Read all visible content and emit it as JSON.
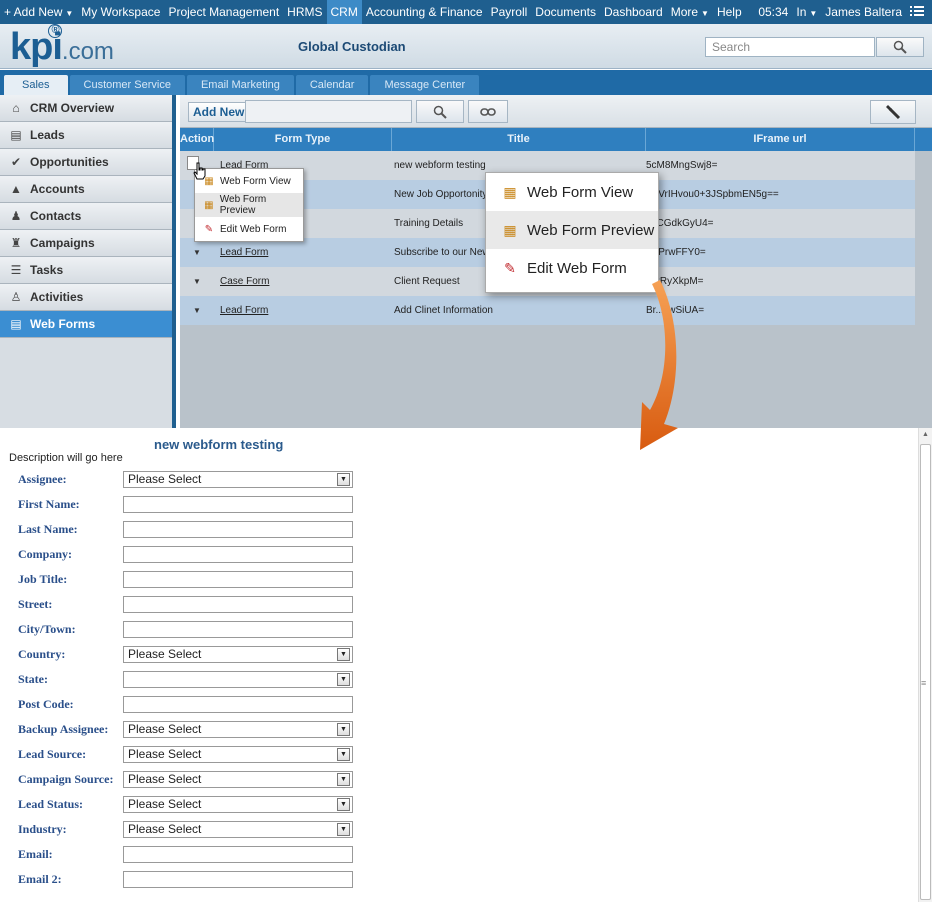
{
  "topnav": {
    "items": [
      "+ Add New",
      "My Workspace",
      "Project Management",
      "HRMS",
      "CRM",
      "Accounting & Finance",
      "Payroll",
      "Documents",
      "Dashboard",
      "More",
      "Help"
    ],
    "time": "05:34",
    "status": "In",
    "user": "James Baltera"
  },
  "header": {
    "logo_main": "kpi",
    "logo_suffix": ".com",
    "logo_mark": "®",
    "company": "Global Custodian",
    "search_placeholder": "Search"
  },
  "module_tabs": [
    "Sales",
    "Customer Service",
    "Email Marketing",
    "Calendar",
    "Message Center"
  ],
  "sidebar": {
    "items": [
      {
        "label": "CRM Overview",
        "icon": "home-icon"
      },
      {
        "label": "Leads",
        "icon": "document-icon"
      },
      {
        "label": "Opportunities",
        "icon": "check-icon"
      },
      {
        "label": "Accounts",
        "icon": "building-icon"
      },
      {
        "label": "Contacts",
        "icon": "contacts-icon"
      },
      {
        "label": "Campaigns",
        "icon": "campaign-icon"
      },
      {
        "label": "Tasks",
        "icon": "tasks-icon"
      },
      {
        "label": "Activities",
        "icon": "activities-icon"
      },
      {
        "label": "Web Forms",
        "icon": "webforms-icon"
      }
    ]
  },
  "toolbar": {
    "add_new": "Add New"
  },
  "grid": {
    "headers": [
      "Action",
      "Form Type",
      "Title",
      "IFrame url"
    ],
    "rows": [
      {
        "form_type": "Lead Form",
        "title": "new webform testing",
        "iframe": "5cM8MngSwj8="
      },
      {
        "form_type": "",
        "title": "New Job Opportonity",
        "iframe": "AuVrIHvou0+3JSpbmEN5g=="
      },
      {
        "form_type": "",
        "title": "Training Details",
        "iframe": "c6CGdkGyU4="
      },
      {
        "form_type": "Lead Form",
        "title": "Subscribe to our Newsletter",
        "iframe": "K0PrwFFY0="
      },
      {
        "form_type": "Case Form",
        "title": "Client Request",
        "iframe": "PjzRyXkpM="
      },
      {
        "form_type": "Lead Form",
        "title": "Add Clinet Information",
        "iframe": "Br..HwSiUA="
      }
    ]
  },
  "action_menu": {
    "items": [
      {
        "label": "Web Form View",
        "icon": "grid-icon"
      },
      {
        "label": "Web Form Preview",
        "icon": "grid-icon"
      },
      {
        "label": "Edit Web Form",
        "icon": "edit-icon"
      }
    ]
  },
  "form": {
    "title": "new webform testing",
    "description": "Description will go here",
    "fields": [
      {
        "label": "Assignee:",
        "value": "Please Select",
        "select": true
      },
      {
        "label": "First Name:",
        "value": "",
        "select": false
      },
      {
        "label": "Last Name:",
        "value": "",
        "select": false
      },
      {
        "label": "Company:",
        "value": "",
        "select": false
      },
      {
        "label": "Job Title:",
        "value": "",
        "select": false
      },
      {
        "label": "Street:",
        "value": "",
        "select": false
      },
      {
        "label": "City/Town:",
        "value": "",
        "select": false
      },
      {
        "label": "Country:",
        "value": "Please Select",
        "select": true
      },
      {
        "label": "State:",
        "value": "",
        "select": true
      },
      {
        "label": "Post Code:",
        "value": "",
        "select": false
      },
      {
        "label": "Backup Assignee:",
        "value": "Please Select",
        "select": true
      },
      {
        "label": "Lead Source:",
        "value": "Please Select",
        "select": true
      },
      {
        "label": "Campaign Source:",
        "value": "Please Select",
        "select": true
      },
      {
        "label": "Lead Status:",
        "value": "Please Select",
        "select": true
      },
      {
        "label": "Industry:",
        "value": "Please Select",
        "select": true
      },
      {
        "label": "Email:",
        "value": "",
        "select": false
      },
      {
        "label": "Email 2:",
        "value": "",
        "select": false
      }
    ]
  },
  "colors": {
    "nav": "#1f5f8f",
    "accent": "#3b8ed2",
    "arrow": "#e8711f"
  }
}
